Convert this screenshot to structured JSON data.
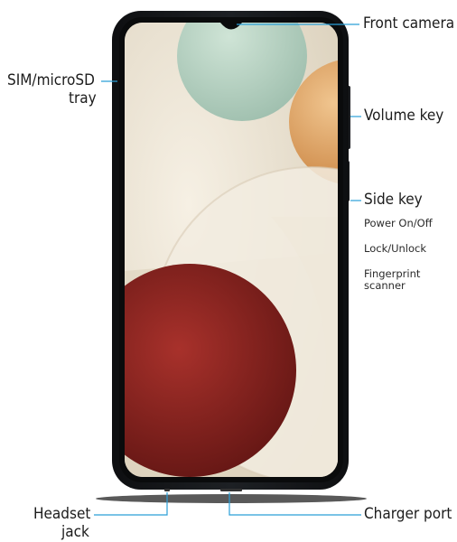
{
  "callouts": {
    "front_camera": "Front camera",
    "sim_tray_line1": "SIM/microSD",
    "sim_tray_line2": "tray",
    "volume_key": "Volume key",
    "side_key": "Side key",
    "side_key_details": [
      "Power On/Off",
      "Lock/Unlock",
      "Fingerprint",
      "scanner"
    ],
    "headset_jack_line1": "Headset",
    "headset_jack_line2": "jack",
    "charger_port": "Charger port"
  },
  "colors": {
    "leader_line": "#2a9fd8",
    "phone_body": "#16181b",
    "wallpaper_base": "#ece3d1",
    "wallpaper_mint": "#b7d2c2",
    "wallpaper_orange": "#e0a869",
    "wallpaper_red": "#8c1f1c"
  }
}
